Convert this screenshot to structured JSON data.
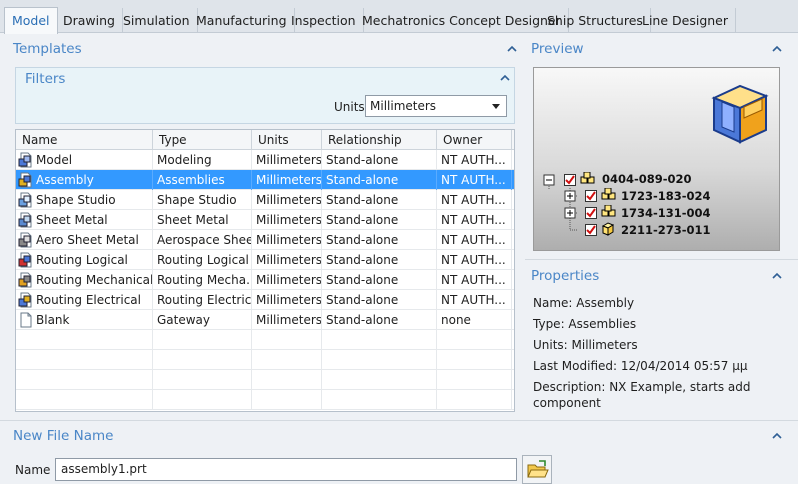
{
  "tabs": [
    "Model",
    "Drawing",
    "Simulation",
    "Manufacturing",
    "Inspection",
    "Mechatronics Concept Designer",
    "Ship Structures",
    "Line Designer"
  ],
  "templates": {
    "title": "Templates",
    "filters": {
      "title": "Filters",
      "units_label": "Units",
      "units_value": "Millimeters"
    },
    "columns": [
      "Name",
      "Type",
      "Units",
      "Relationship",
      "Owner"
    ],
    "rows": [
      {
        "name": "Model",
        "type": "Modeling",
        "units": "Millimeters",
        "relationship": "Stand-alone",
        "owner": "NT AUTH...",
        "icon": "model-icon"
      },
      {
        "name": "Assembly",
        "type": "Assemblies",
        "units": "Millimeters",
        "relationship": "Stand-alone",
        "owner": "NT AUTH...",
        "icon": "assembly-icon",
        "selected": true
      },
      {
        "name": "Shape Studio",
        "type": "Shape Studio",
        "units": "Millimeters",
        "relationship": "Stand-alone",
        "owner": "NT AUTH...",
        "icon": "shape-studio-icon"
      },
      {
        "name": "Sheet Metal",
        "type": "Sheet Metal",
        "units": "Millimeters",
        "relationship": "Stand-alone",
        "owner": "NT AUTH...",
        "icon": "sheet-metal-icon"
      },
      {
        "name": "Aero Sheet Metal",
        "type": "Aerospace Shee...",
        "units": "Millimeters",
        "relationship": "Stand-alone",
        "owner": "NT AUTH...",
        "icon": "aero-sheet-metal-icon"
      },
      {
        "name": "Routing Logical",
        "type": "Routing Logical",
        "units": "Millimeters",
        "relationship": "Stand-alone",
        "owner": "NT AUTH...",
        "icon": "routing-logical-icon"
      },
      {
        "name": "Routing Mechanical",
        "type": "Routing Mecha...",
        "units": "Millimeters",
        "relationship": "Stand-alone",
        "owner": "NT AUTH...",
        "icon": "routing-mechanical-icon"
      },
      {
        "name": "Routing Electrical",
        "type": "Routing Electrical",
        "units": "Millimeters",
        "relationship": "Stand-alone",
        "owner": "NT AUTH...",
        "icon": "routing-electrical-icon"
      },
      {
        "name": "Blank",
        "type": "Gateway",
        "units": "Millimeters",
        "relationship": "Stand-alone",
        "owner": "none",
        "icon": "blank-file-icon"
      }
    ]
  },
  "preview": {
    "title": "Preview",
    "tree": [
      "0404-089-020",
      "1723-183-024",
      "1734-131-004",
      "2211-273-011"
    ]
  },
  "properties": {
    "title": "Properties",
    "name": "Name: Assembly",
    "type": "Type: Assemblies",
    "units": "Units: Millimeters",
    "last_modified": "Last Modified: 12/04/2014 05:57 μμ",
    "description_line1": "Description: NX Example, starts add",
    "description_line2": "component"
  },
  "new_file": {
    "title": "New File Name",
    "name_label": "Name",
    "name_value": "assembly1.prt"
  },
  "colors": {
    "accent": "#4a86c7",
    "selection": "#3399ff"
  }
}
